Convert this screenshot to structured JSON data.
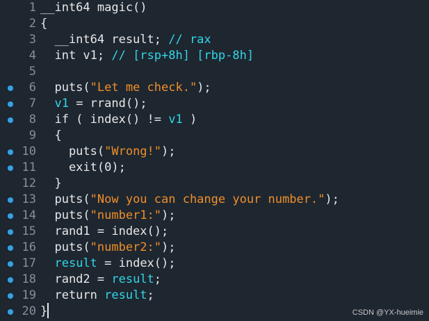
{
  "colors": {
    "background": "#1e2630",
    "text": "#e8e8e8",
    "variable": "#32d6e6",
    "string": "#f0902a",
    "line_number": "#8a8f96",
    "breakpoint": "#35a2e8"
  },
  "lines": [
    {
      "n": "1",
      "bp": false,
      "tokens": [
        [
          "kw",
          "__int64 magic()"
        ]
      ]
    },
    {
      "n": "2",
      "bp": false,
      "tokens": [
        [
          "kw",
          "{"
        ]
      ]
    },
    {
      "n": "3",
      "bp": false,
      "tokens": [
        [
          "kw",
          "  __int64 result; "
        ],
        [
          "cmt",
          "// rax"
        ]
      ]
    },
    {
      "n": "4",
      "bp": false,
      "tokens": [
        [
          "kw",
          "  int v1; "
        ],
        [
          "cmt",
          "// [rsp+8h] [rbp-8h]"
        ]
      ]
    },
    {
      "n": "5",
      "bp": false,
      "tokens": []
    },
    {
      "n": "6",
      "bp": true,
      "tokens": [
        [
          "kw",
          "  puts("
        ],
        [
          "str",
          "\"Let me check.\""
        ],
        [
          "kw",
          ");"
        ]
      ]
    },
    {
      "n": "7",
      "bp": true,
      "tokens": [
        [
          "kw",
          "  "
        ],
        [
          "var",
          "v1"
        ],
        [
          "kw",
          " = rrand();"
        ]
      ]
    },
    {
      "n": "8",
      "bp": true,
      "tokens": [
        [
          "kw",
          "  if ( index() != "
        ],
        [
          "var",
          "v1"
        ],
        [
          "kw",
          " )"
        ]
      ]
    },
    {
      "n": "9",
      "bp": false,
      "tokens": [
        [
          "kw",
          "  {"
        ]
      ]
    },
    {
      "n": "10",
      "bp": true,
      "tokens": [
        [
          "kw",
          "    puts("
        ],
        [
          "str",
          "\"Wrong!\""
        ],
        [
          "kw",
          ");"
        ]
      ]
    },
    {
      "n": "11",
      "bp": true,
      "tokens": [
        [
          "kw",
          "    exit("
        ],
        [
          "num",
          "0"
        ],
        [
          "kw",
          ");"
        ]
      ]
    },
    {
      "n": "12",
      "bp": false,
      "tokens": [
        [
          "kw",
          "  }"
        ]
      ]
    },
    {
      "n": "13",
      "bp": true,
      "tokens": [
        [
          "kw",
          "  puts("
        ],
        [
          "str",
          "\"Now you can change your number.\""
        ],
        [
          "kw",
          ");"
        ]
      ]
    },
    {
      "n": "14",
      "bp": true,
      "tokens": [
        [
          "kw",
          "  puts("
        ],
        [
          "str",
          "\"number1:\""
        ],
        [
          "kw",
          ");"
        ]
      ]
    },
    {
      "n": "15",
      "bp": true,
      "tokens": [
        [
          "kw",
          "  rand1 = index();"
        ]
      ]
    },
    {
      "n": "16",
      "bp": true,
      "tokens": [
        [
          "kw",
          "  puts("
        ],
        [
          "str",
          "\"number2:\""
        ],
        [
          "kw",
          ");"
        ]
      ]
    },
    {
      "n": "17",
      "bp": true,
      "tokens": [
        [
          "kw",
          "  "
        ],
        [
          "var",
          "result"
        ],
        [
          "kw",
          " = index();"
        ]
      ]
    },
    {
      "n": "18",
      "bp": true,
      "tokens": [
        [
          "kw",
          "  rand2 = "
        ],
        [
          "var",
          "result"
        ],
        [
          "kw",
          ";"
        ]
      ]
    },
    {
      "n": "19",
      "bp": true,
      "tokens": [
        [
          "kw",
          "  return "
        ],
        [
          "var",
          "result"
        ],
        [
          "kw",
          ";"
        ]
      ]
    },
    {
      "n": "20",
      "bp": true,
      "tokens": [
        [
          "kw",
          "}"
        ]
      ]
    }
  ],
  "watermark": "CSDN @YX-hueimie"
}
